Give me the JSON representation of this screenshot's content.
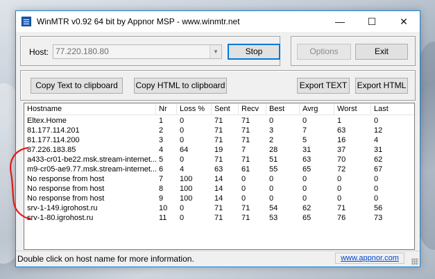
{
  "window": {
    "title": "WinMTR v0.92 64 bit by Appnor MSP - www.winmtr.net"
  },
  "toolbar": {
    "host_label": "Host:",
    "host_value": "77.220.180.80",
    "stop_label": "Stop",
    "options_label": "Options",
    "exit_label": "Exit",
    "copy_text_label": "Copy Text to clipboard",
    "copy_html_label": "Copy HTML to clipboard",
    "export_text_label": "Export TEXT",
    "export_html_label": "Export HTML"
  },
  "columns": [
    "Hostname",
    "Nr",
    "Loss %",
    "Sent",
    "Recv",
    "Best",
    "Avrg",
    "Worst",
    "Last"
  ],
  "rows": [
    [
      "Eltex.Home",
      "1",
      "0",
      "71",
      "71",
      "0",
      "0",
      "1",
      "0"
    ],
    [
      "81.177.114.201",
      "2",
      "0",
      "71",
      "71",
      "3",
      "7",
      "63",
      "12"
    ],
    [
      "81.177.114.200",
      "3",
      "0",
      "71",
      "71",
      "2",
      "5",
      "16",
      "4"
    ],
    [
      "87.226.183.85",
      "4",
      "64",
      "19",
      "7",
      "28",
      "31",
      "37",
      "31"
    ],
    [
      "a433-cr01-be22.msk.stream-internet....",
      "5",
      "0",
      "71",
      "71",
      "51",
      "63",
      "70",
      "62"
    ],
    [
      "m9-cr05-ae9.77.msk.stream-internet....",
      "6",
      "4",
      "63",
      "61",
      "55",
      "65",
      "72",
      "67"
    ],
    [
      "No response from host",
      "7",
      "100",
      "14",
      "0",
      "0",
      "0",
      "0",
      "0"
    ],
    [
      "No response from host",
      "8",
      "100",
      "14",
      "0",
      "0",
      "0",
      "0",
      "0"
    ],
    [
      "No response from host",
      "9",
      "100",
      "14",
      "0",
      "0",
      "0",
      "0",
      "0"
    ],
    [
      "srv-1-149.igrohost.ru",
      "10",
      "0",
      "71",
      "71",
      "54",
      "62",
      "71",
      "56"
    ],
    [
      "srv-1-80.igrohost.ru",
      "11",
      "0",
      "71",
      "71",
      "53",
      "65",
      "76",
      "73"
    ]
  ],
  "status": {
    "text": "Double click on host name for more information.",
    "link": "www.appnor.com"
  },
  "icons": {
    "app": "winmtr-app-icon",
    "minimize": "minimize-icon",
    "maximize": "maximize-icon",
    "close": "close-icon",
    "dropdown": "chevron-down-icon"
  },
  "colors": {
    "accent": "#0078d7",
    "annotation": "#e0191d",
    "link": "#0044cc"
  }
}
